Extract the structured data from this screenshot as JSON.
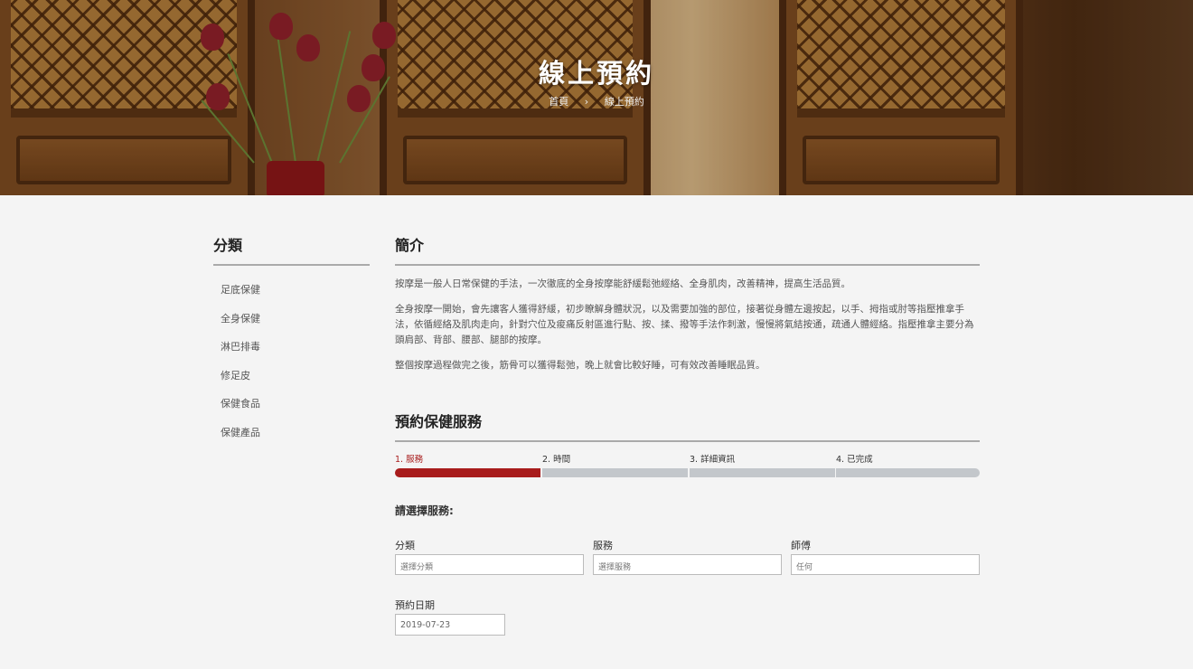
{
  "hero": {
    "title": "線上預約",
    "breadcrumb": {
      "home": "首頁",
      "separator": "›",
      "current": "線上預約"
    }
  },
  "sidebar": {
    "title": "分類",
    "items": [
      {
        "label": "足底保健"
      },
      {
        "label": "全身保健"
      },
      {
        "label": "淋巴排毒"
      },
      {
        "label": "修足皮"
      },
      {
        "label": "保健食品"
      },
      {
        "label": "保健產品"
      }
    ]
  },
  "intro": {
    "title": "簡介",
    "paragraphs": [
      "按摩是一般人日常保健的手法，一次徹底的全身按摩能舒緩鬆弛經絡、全身肌肉，改善精神，提高生活品質。",
      "全身按摩一開始，會先讓客人獲得舒緩，初步瞭解身體狀況，以及需要加強的部位，接著從身體左邊按起，以手、拇指或肘等指壓推拿手法，依循經絡及肌肉走向，針對穴位及痠痛反射區進行點、按、揉、撥等手法作刺激，慢慢將氣結按通，疏通人體經絡。指壓推拿主要分為頭肩部、背部、腰部、腿部的按摩。",
      "整個按摩過程做完之後，筋骨可以獲得鬆弛，晚上就會比較好睡，可有效改善睡眠品質。"
    ]
  },
  "booking": {
    "title": "預約保健服務",
    "steps": [
      {
        "label": "1. 服務",
        "active": true
      },
      {
        "label": "2. 時間",
        "active": false
      },
      {
        "label": "3. 詳細資訊",
        "active": false
      },
      {
        "label": "4. 已完成",
        "active": false
      }
    ],
    "choose_label": "請選擇服務:",
    "fields": {
      "category": {
        "label": "分類",
        "placeholder": "選擇分類"
      },
      "service": {
        "label": "服務",
        "placeholder": "選擇服務"
      },
      "staff": {
        "label": "師傅",
        "placeholder": "任何"
      }
    },
    "date": {
      "label": "預約日期",
      "value": "2019-07-23"
    }
  },
  "colors": {
    "accent": "#a81c1c",
    "step_inactive": "#c3c7cb",
    "background": "#f4f4f4"
  }
}
